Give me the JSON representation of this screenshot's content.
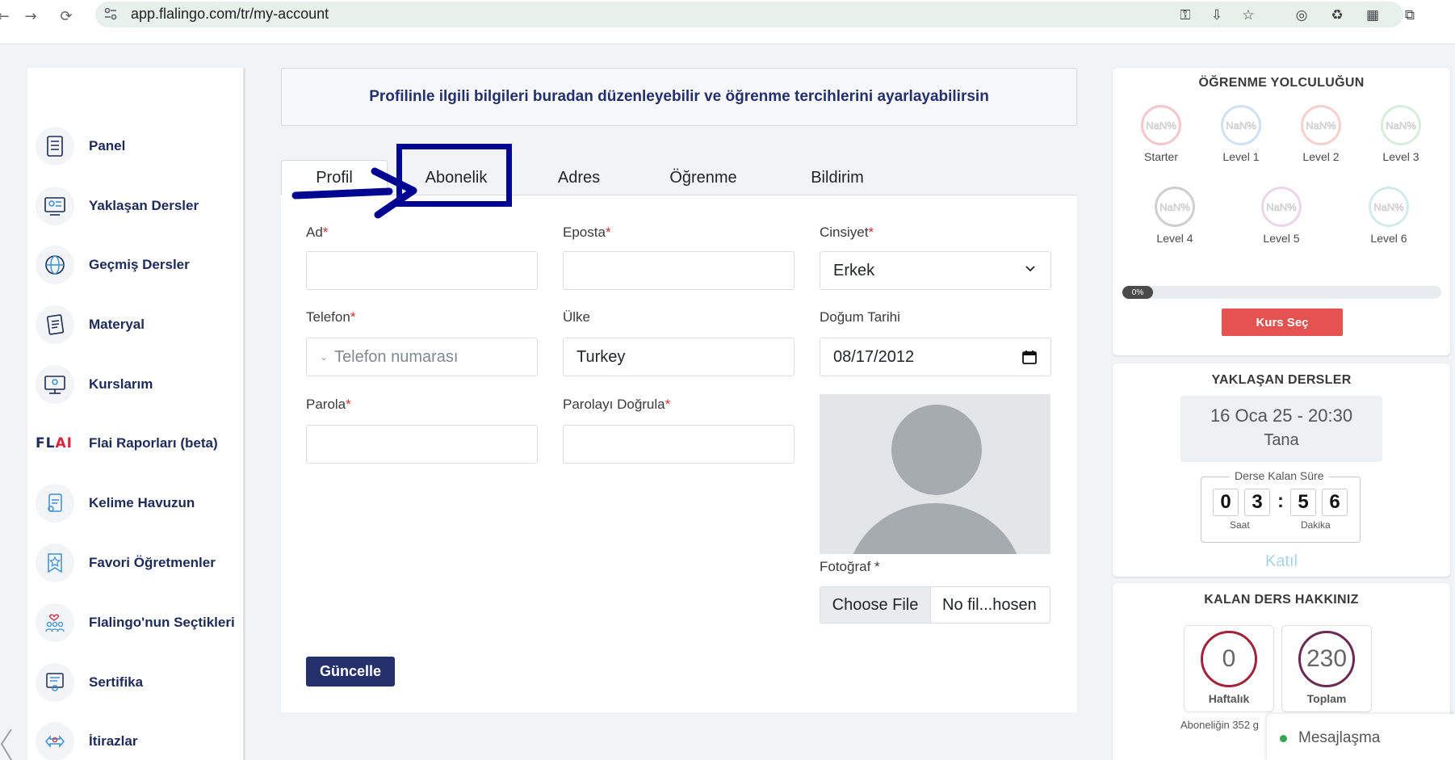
{
  "browser": {
    "url": "app.flalingo.com/tr/my-account"
  },
  "sidebar": {
    "items": [
      {
        "label": "Panel",
        "icon": "dashboard-icon"
      },
      {
        "label": "Yaklaşan Dersler",
        "icon": "upcoming-lessons-icon"
      },
      {
        "label": "Geçmiş Dersler",
        "icon": "past-lessons-icon"
      },
      {
        "label": "Materyal",
        "icon": "material-icon"
      },
      {
        "label": "Kurslarım",
        "icon": "courses-icon"
      },
      {
        "label": "Flai Raporları (beta)",
        "icon": "flai-logo"
      },
      {
        "label": "Kelime Havuzun",
        "icon": "word-pool-icon"
      },
      {
        "label": "Favori Öğretmenler",
        "icon": "favorite-teachers-icon"
      },
      {
        "label": "Flalingo'nun Seçtikleri",
        "icon": "picks-icon"
      },
      {
        "label": "Sertifika",
        "icon": "certificate-icon"
      },
      {
        "label": "İtirazlar",
        "icon": "objections-icon"
      }
    ],
    "flai_logo_text": "FL",
    "flai_logo_red": "AI"
  },
  "banner": {
    "text": "Profilinle ilgili bilgileri buradan düzenleyebilir ve öğrenme tercihlerini ayarlayabilirsin"
  },
  "tabs": [
    {
      "label": "Profil",
      "active": true
    },
    {
      "label": "Abonelik",
      "active": false
    },
    {
      "label": "Adres",
      "active": false
    },
    {
      "label": "Öğrenme",
      "active": false
    },
    {
      "label": "Bildirim",
      "active": false
    }
  ],
  "form": {
    "ad_label": "Ad",
    "eposta_label": "Eposta",
    "cinsiyet_label": "Cinsiyet",
    "cinsiyet_value": "Erkek",
    "telefon_label": "Telefon",
    "telefon_placeholder": "Telefon numarası",
    "ulke_label": "Ülke",
    "ulke_value": "Turkey",
    "dogum_label": "Doğum Tarihi",
    "dogum_value": "08/17/2012",
    "parola_label": "Parola",
    "parola_dogrula_label": "Parolayı Doğrula",
    "fotograf_label": "Fotoğraf *",
    "file_button": "Choose File",
    "file_name": "No fil...hosen",
    "required_mark": "*",
    "submit": "Güncelle"
  },
  "journey": {
    "title": "ÖĞRENME YOLCULUĞUN",
    "levels": [
      {
        "name": "Starter",
        "value": "NaN%",
        "color": "#f4c7cf"
      },
      {
        "name": "Level 1",
        "value": "NaN%",
        "color": "#cfe1f3"
      },
      {
        "name": "Level 2",
        "value": "NaN%",
        "color": "#f6cfcf"
      },
      {
        "name": "Level 3",
        "value": "NaN%",
        "color": "#d7eedc"
      },
      {
        "name": "Level 4",
        "value": "NaN%",
        "color": "#cfcfcf"
      },
      {
        "name": "Level 5",
        "value": "NaN%",
        "color": "#ecd6ea"
      },
      {
        "name": "Level 6",
        "value": "NaN%",
        "color": "#d3ece7"
      }
    ],
    "progress_label": "0%",
    "progress_value": 0,
    "button": "Kurs Seç"
  },
  "upcoming": {
    "title": "YAKLAŞAN DERSLER",
    "date": "16 Oca 25 - 20:30",
    "teacher": "Tana",
    "countdown_title": "Derse Kalan Süre",
    "digits": [
      "0",
      "3",
      "5",
      "6"
    ],
    "separator": ":",
    "hour_label": "Saat",
    "minute_label": "Dakika",
    "join": "Katıl"
  },
  "remaining": {
    "title": "KALAN DERS HAKKINIZ",
    "weekly_value": "0",
    "weekly_label": "Haftalık",
    "weekly_color": "#a3213a",
    "total_value": "230",
    "total_label": "Toplam",
    "total_color": "#6b2a52",
    "subscription_text": "Aboneliğin 352 g"
  },
  "messages": {
    "label": "Mesajlaşma",
    "status_color": "#2fa84f"
  }
}
